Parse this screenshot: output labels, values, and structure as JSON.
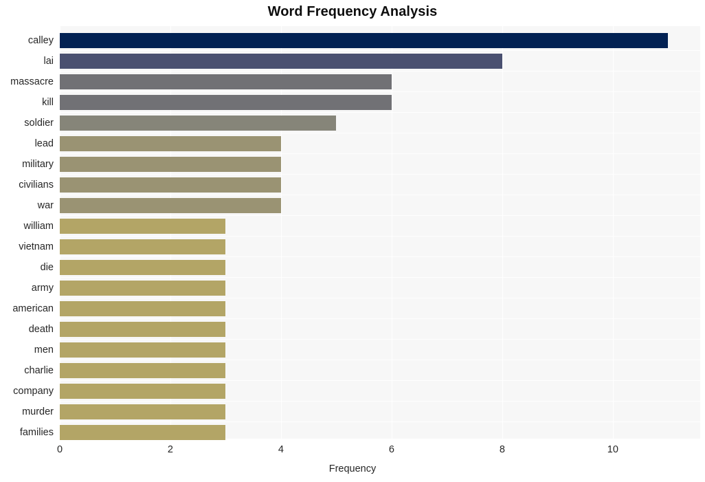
{
  "chart_data": {
    "type": "bar",
    "orientation": "horizontal",
    "title": "Word Frequency Analysis",
    "xlabel": "Frequency",
    "ylabel": "",
    "categories": [
      "calley",
      "lai",
      "massacre",
      "kill",
      "soldier",
      "lead",
      "military",
      "civilians",
      "war",
      "william",
      "vietnam",
      "die",
      "army",
      "american",
      "death",
      "men",
      "charlie",
      "company",
      "murder",
      "families"
    ],
    "values": [
      11,
      8,
      6,
      6,
      5,
      4,
      4,
      4,
      4,
      3,
      3,
      3,
      3,
      3,
      3,
      3,
      3,
      3,
      3,
      3
    ],
    "bar_colors": [
      "#032253",
      "#4a5070",
      "#717175",
      "#717175",
      "#868579",
      "#9a9373",
      "#9a9373",
      "#9a9373",
      "#9a9373",
      "#b3a566",
      "#b3a566",
      "#b3a566",
      "#b3a566",
      "#b3a566",
      "#b3a566",
      "#b3a566",
      "#b3a566",
      "#b3a566",
      "#b3a566",
      "#b3a566"
    ],
    "xticks": [
      0,
      2,
      4,
      6,
      8,
      10
    ],
    "xtick_labels": [
      "0",
      "2",
      "4",
      "6",
      "8",
      "10"
    ],
    "xlim": [
      0,
      11.58
    ],
    "grid": true,
    "grid_axis": "x",
    "legend": null,
    "plot_background": "#f7f7f7",
    "figure_background": "#ffffff",
    "title_color": "#0d0d0d",
    "tick_color": "#262626"
  }
}
